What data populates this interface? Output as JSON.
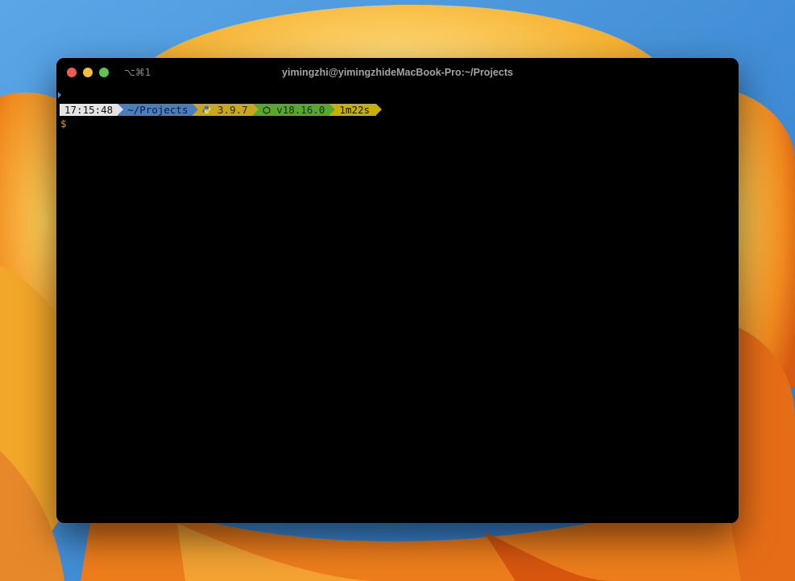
{
  "window": {
    "title": "yimingzhi@yimingzhideMacBook-Pro:~/Projects",
    "shortcut": "⌥⌘1",
    "traffic_lights": {
      "close_color": "#ee5c50",
      "minimize_color": "#f3bd3f",
      "maximize_color": "#5fc452"
    }
  },
  "terminal": {
    "prompt_segments": {
      "time": "17:15:48",
      "path": "~/Projects",
      "python_icon": "python-snake-icon",
      "python_version": "3.9.7",
      "node_icon": "node-hexagon-icon",
      "node_version": "v18.16.0",
      "duration": "1m22s"
    },
    "prompt_symbol": "$",
    "colors": {
      "time_bg": "#e4e4e4",
      "path_bg": "#4a7fbf",
      "python_bg": "#c8a620",
      "node_bg": "#58a630",
      "duration_bg": "#c8b000",
      "prompt_symbol": "#d8a42a"
    }
  }
}
